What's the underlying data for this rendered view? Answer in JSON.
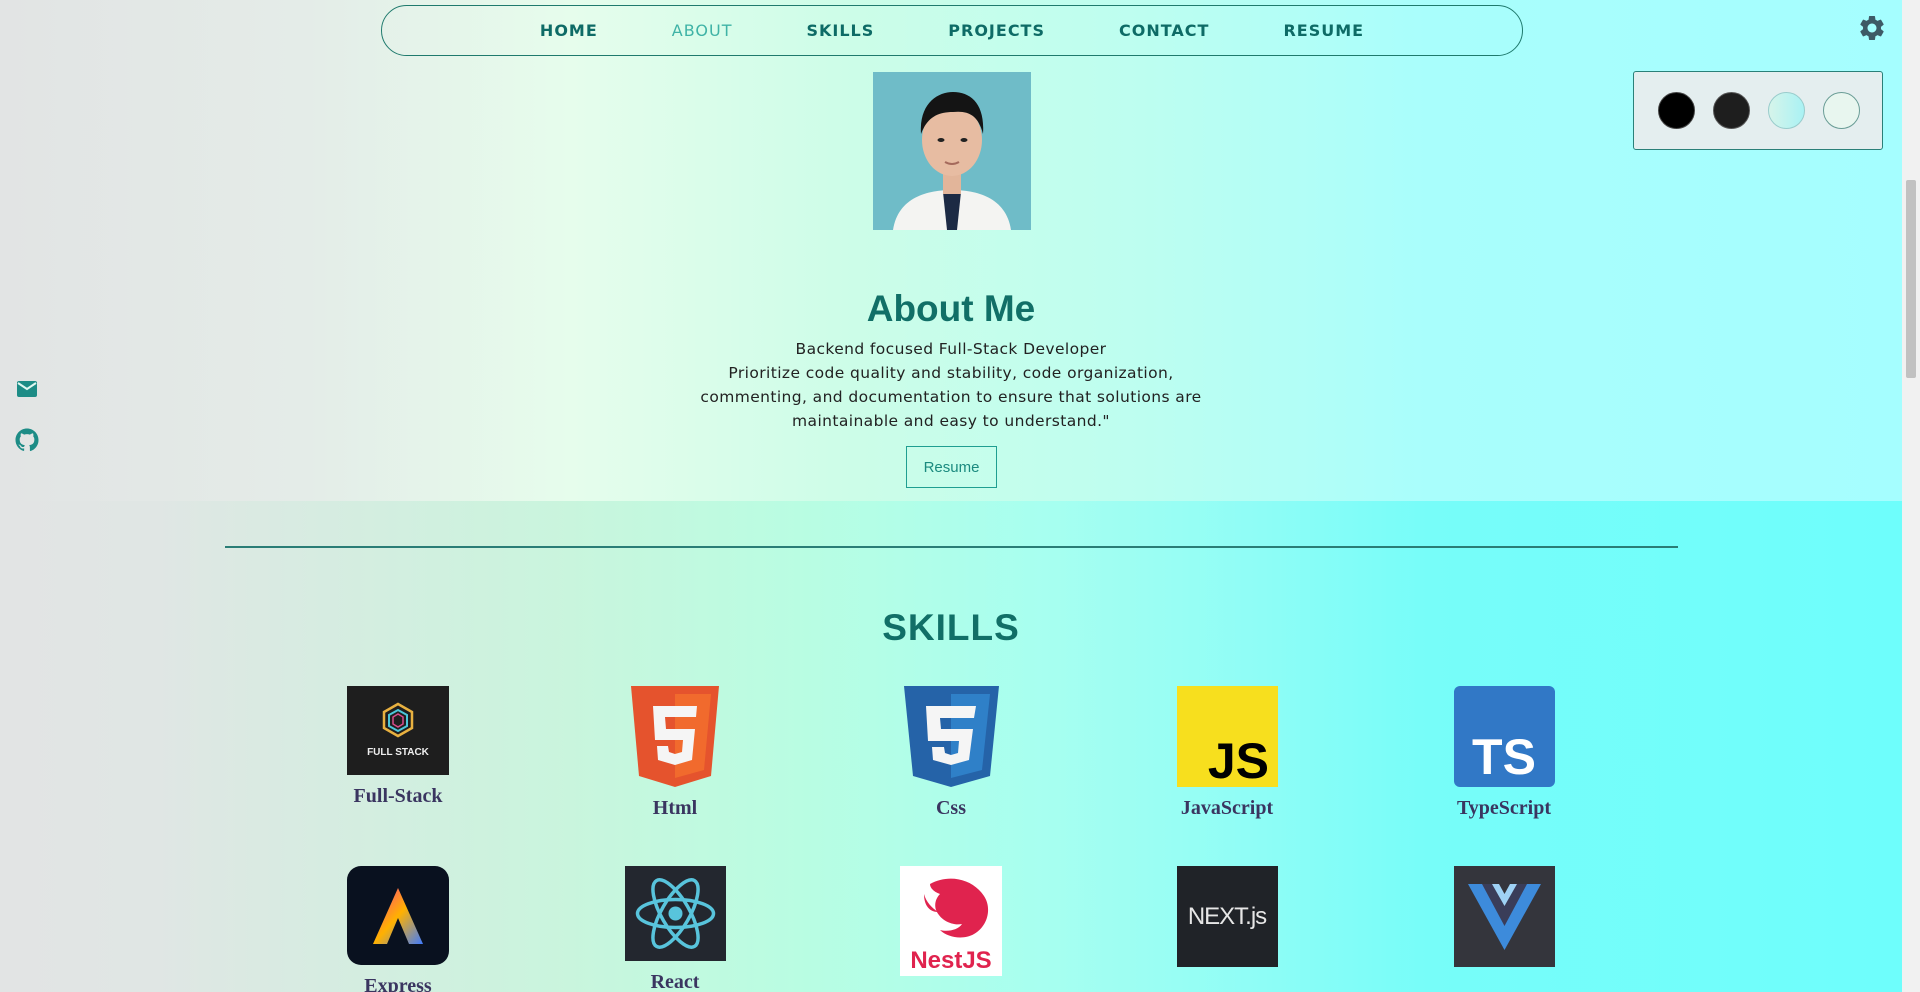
{
  "nav": {
    "items": [
      "HOME",
      "ABOUT",
      "SKILLS",
      "PROJECTS",
      "CONTACT",
      "RESUME"
    ],
    "active": "ABOUT"
  },
  "theme_swatches": [
    "#000000",
    "#1e1e1e",
    "#b8f3ee",
    "#e8f6ef"
  ],
  "about": {
    "title": "About Me",
    "line1": "Backend focused Full-Stack Developer",
    "line2": "Prioritize code quality and stability, code organization,",
    "line3": "commenting, and documentation to ensure that solutions are",
    "line4": "maintainable and easy to understand.\"",
    "resume_button": "Resume"
  },
  "skills": {
    "title": "SKILLS",
    "row1": [
      "Full-Stack",
      "Html",
      "Css",
      "JavaScript",
      "TypeScript"
    ],
    "row2": [
      "Express",
      "React",
      "NestJS",
      "NextJS",
      "Vue"
    ],
    "fullstack_logo_text": "FULL STACK",
    "nestjs_logo_text": "NestJS",
    "nextjs_logo_text": "NEXT.js",
    "js_logo_text": "JS",
    "ts_logo_text": "TS"
  },
  "icons": {
    "settings": "gear-icon",
    "mail": "mail-icon",
    "github": "github-icon"
  },
  "colors": {
    "accent": "#116f67",
    "nav_text": "#0e6b66",
    "nav_active": "#3fb3a6"
  }
}
